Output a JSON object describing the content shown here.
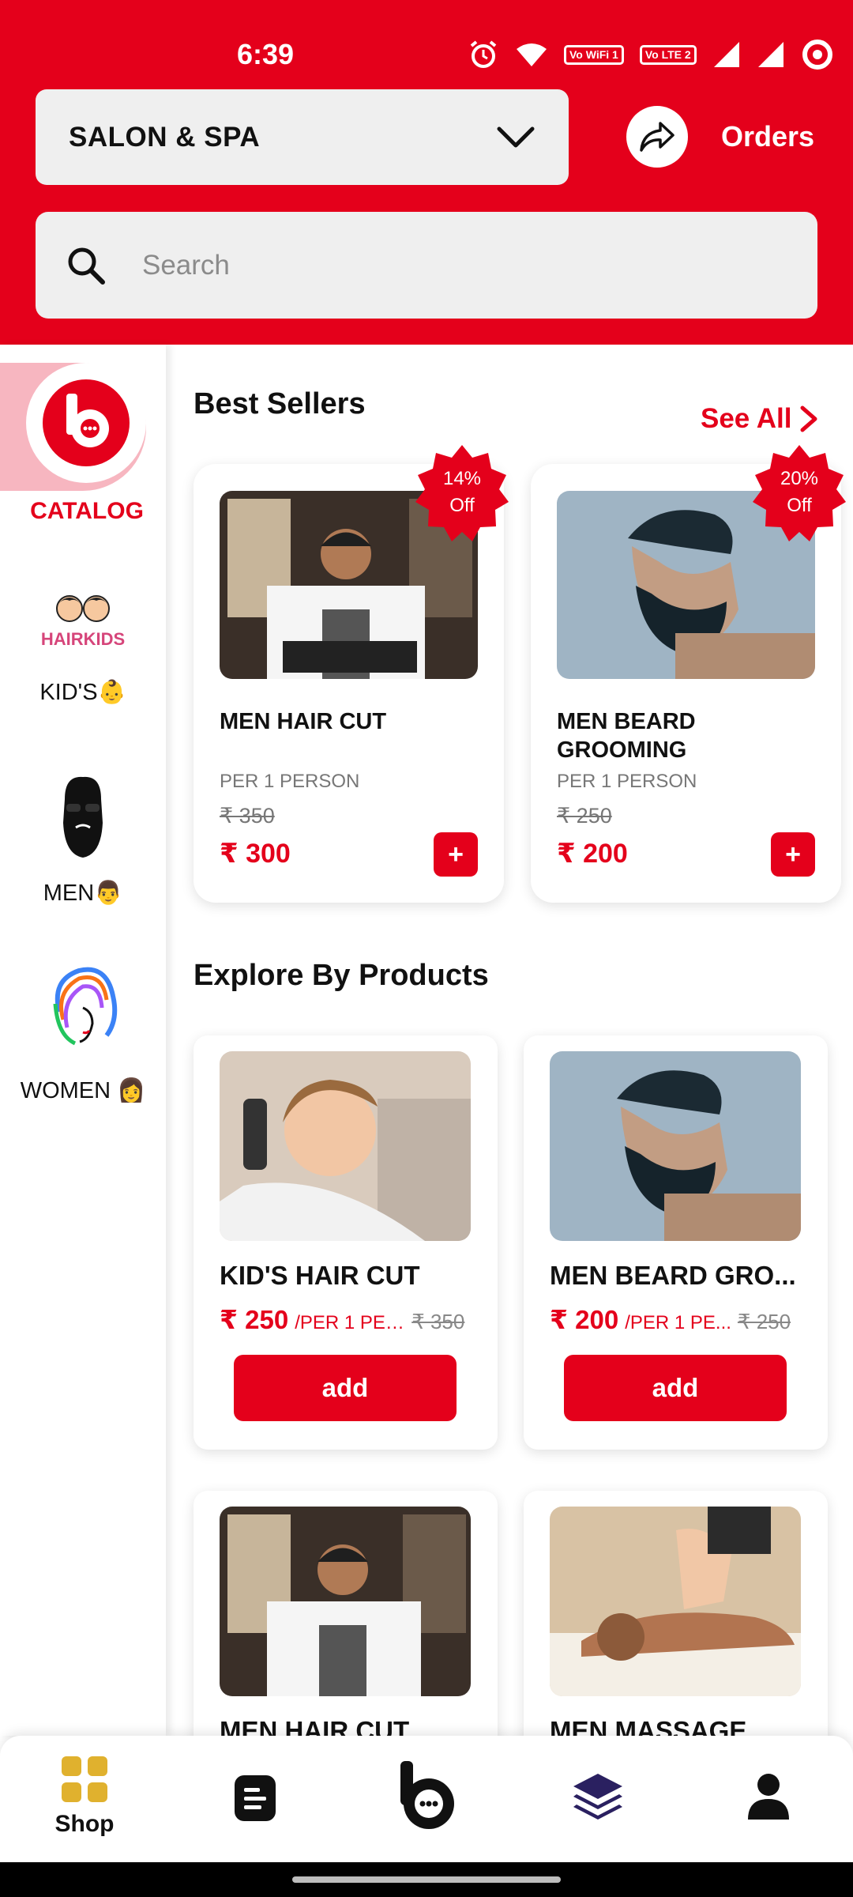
{
  "status_bar": {
    "time": "6:39",
    "indicators": [
      "Vo WiFi 1",
      "Vo LTE 2"
    ],
    "icons": [
      "alarm-icon",
      "wifi-icon",
      "signal-icon",
      "signal-icon",
      "battery-icon"
    ]
  },
  "header": {
    "store_type": "SALON & SPA",
    "orders_label": "Orders",
    "search_placeholder": "Search",
    "colors": {
      "brand": "#e4001b"
    }
  },
  "sidebar": {
    "items": [
      {
        "label": "CATALOG",
        "icon": "brand-logo-icon",
        "active": true
      },
      {
        "label": "KID'S👶",
        "icon": "hairkids-logo-icon"
      },
      {
        "label": "MEN👨",
        "icon": "bearded-man-icon"
      },
      {
        "label": "WOMEN 👩",
        "icon": "woman-hair-icon"
      }
    ],
    "hairkids_text": "HAIRKIDS"
  },
  "best_sellers": {
    "title": "Best Sellers",
    "see_all": "See All",
    "items": [
      {
        "name": "MEN HAIR CUT",
        "unit": "PER 1 PERSON",
        "mrp": "₹ 350",
        "price": "₹ 300",
        "badge_pct": "14%",
        "badge_off": "Off",
        "plus": "+"
      },
      {
        "name": "MEN BEARD GROOMING",
        "unit": "PER 1 PERSON",
        "mrp": "₹ 250",
        "price": "₹ 200",
        "badge_pct": "20%",
        "badge_off": "Off",
        "plus": "+"
      }
    ]
  },
  "explore": {
    "title": "Explore By Products",
    "items": [
      {
        "name": "KID'S HAIR CUT",
        "price": "₹ 250",
        "unit": "/PER 1 PER...",
        "mrp": "₹ 350",
        "button": "add"
      },
      {
        "name": "MEN BEARD GRO...",
        "price": "₹ 200",
        "unit": "/PER 1 PE...",
        "mrp": "₹ 250",
        "button": "add"
      },
      {
        "name": "MEN HAIR CUT"
      },
      {
        "name": "MEN MASSAGE"
      }
    ]
  },
  "bottom_nav": {
    "items": [
      {
        "label": "Shop",
        "icon": "grid-icon",
        "active": true
      },
      {
        "label": "",
        "icon": "document-icon"
      },
      {
        "label": "",
        "icon": "brand-logo-icon"
      },
      {
        "label": "",
        "icon": "layers-icon"
      },
      {
        "label": "",
        "icon": "profile-icon"
      }
    ]
  }
}
